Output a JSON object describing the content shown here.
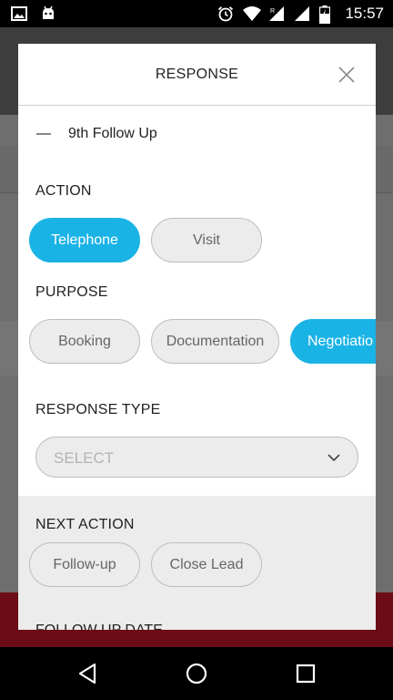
{
  "status_bar": {
    "time": "15:57",
    "left_icons": [
      "image-notification-icon",
      "android-notification-icon"
    ],
    "right_icons": [
      "alarm-icon",
      "wifi-icon",
      "cell-signal-roaming-icon",
      "cell-signal-icon",
      "battery-charging-icon"
    ]
  },
  "dialog": {
    "title": "RESPONSE",
    "followup_label": "9th Follow Up",
    "action": {
      "label": "ACTION",
      "options": [
        {
          "label": "Telephone",
          "selected": true
        },
        {
          "label": "Visit",
          "selected": false
        }
      ]
    },
    "purpose": {
      "label": "PURPOSE",
      "options": [
        {
          "label": "Booking",
          "selected": false
        },
        {
          "label": "Documentation",
          "selected": false
        },
        {
          "label": "Negotiatio",
          "selected": true
        }
      ]
    },
    "response_type": {
      "label": "RESPONSE TYPE",
      "select_placeholder": "SELECT"
    },
    "next_action": {
      "label": "NEXT ACTION",
      "options": [
        {
          "label": "Follow-up",
          "selected": false
        },
        {
          "label": "Close Lead",
          "selected": false
        }
      ]
    },
    "cut_off_label": "FOLLOW UP DATE"
  },
  "colors": {
    "accent": "#1ab3e6",
    "pill_bg": "#ececec",
    "section_bg": "#ececec"
  }
}
